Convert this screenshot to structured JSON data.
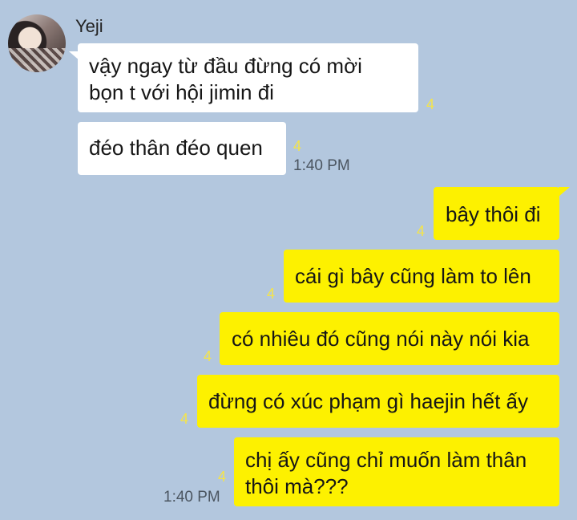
{
  "contact": {
    "name": "Yeji"
  },
  "incoming": [
    {
      "line1": "vậy ngay từ đầu đừng có mời",
      "line2": "bọn t với hội jimin đi",
      "read": "4"
    },
    {
      "text": "đéo thân đéo quen",
      "read": "4",
      "time": "1:40 PM"
    }
  ],
  "outgoing": [
    {
      "text": "bây thôi đi",
      "read": "4"
    },
    {
      "text": "cái gì bây cũng làm to lên",
      "read": "4"
    },
    {
      "text": "có nhiêu đó cũng nói này nói kia",
      "read": "4"
    },
    {
      "text": "đừng có xúc phạm gì haejin hết ấy",
      "read": "4"
    },
    {
      "line1": "chị ấy cũng chỉ muốn làm thân",
      "line2": "thôi mà???",
      "read": "4",
      "time": "1:40 PM"
    }
  ],
  "colors": {
    "background": "#b3c7de",
    "incoming_bubble": "#ffffff",
    "outgoing_bubble": "#fdf100",
    "read_count": "#f4e44a"
  }
}
